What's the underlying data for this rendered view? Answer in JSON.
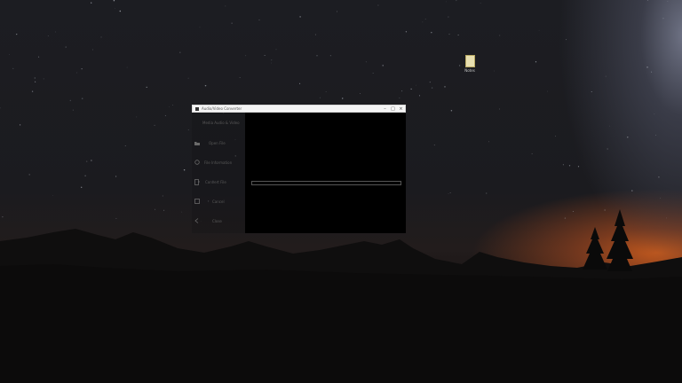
{
  "desktop": {
    "file_icon": {
      "icon": "document-icon",
      "label": "Notes"
    }
  },
  "window": {
    "title": "Audio/Video Converter",
    "controls": {
      "minimize": "–",
      "maximize": "□",
      "close": "×"
    },
    "sidebar": {
      "app_name": "Media Audio & Video",
      "items": [
        {
          "label": "Open File",
          "icon": "folder-icon"
        },
        {
          "label": "File Information",
          "icon": "chat-bubble-icon"
        },
        {
          "label": "Convert File",
          "icon": "convert-file-icon"
        },
        {
          "label": "Cancel",
          "icon": "stop-icon"
        },
        {
          "label": "Close",
          "icon": "exit-icon"
        }
      ]
    },
    "progress": {
      "value": 0
    }
  },
  "colors": {
    "window_bg": "#000000",
    "sidebar_text": "#5a5a5a",
    "titlebar": "#f4f4f4"
  }
}
